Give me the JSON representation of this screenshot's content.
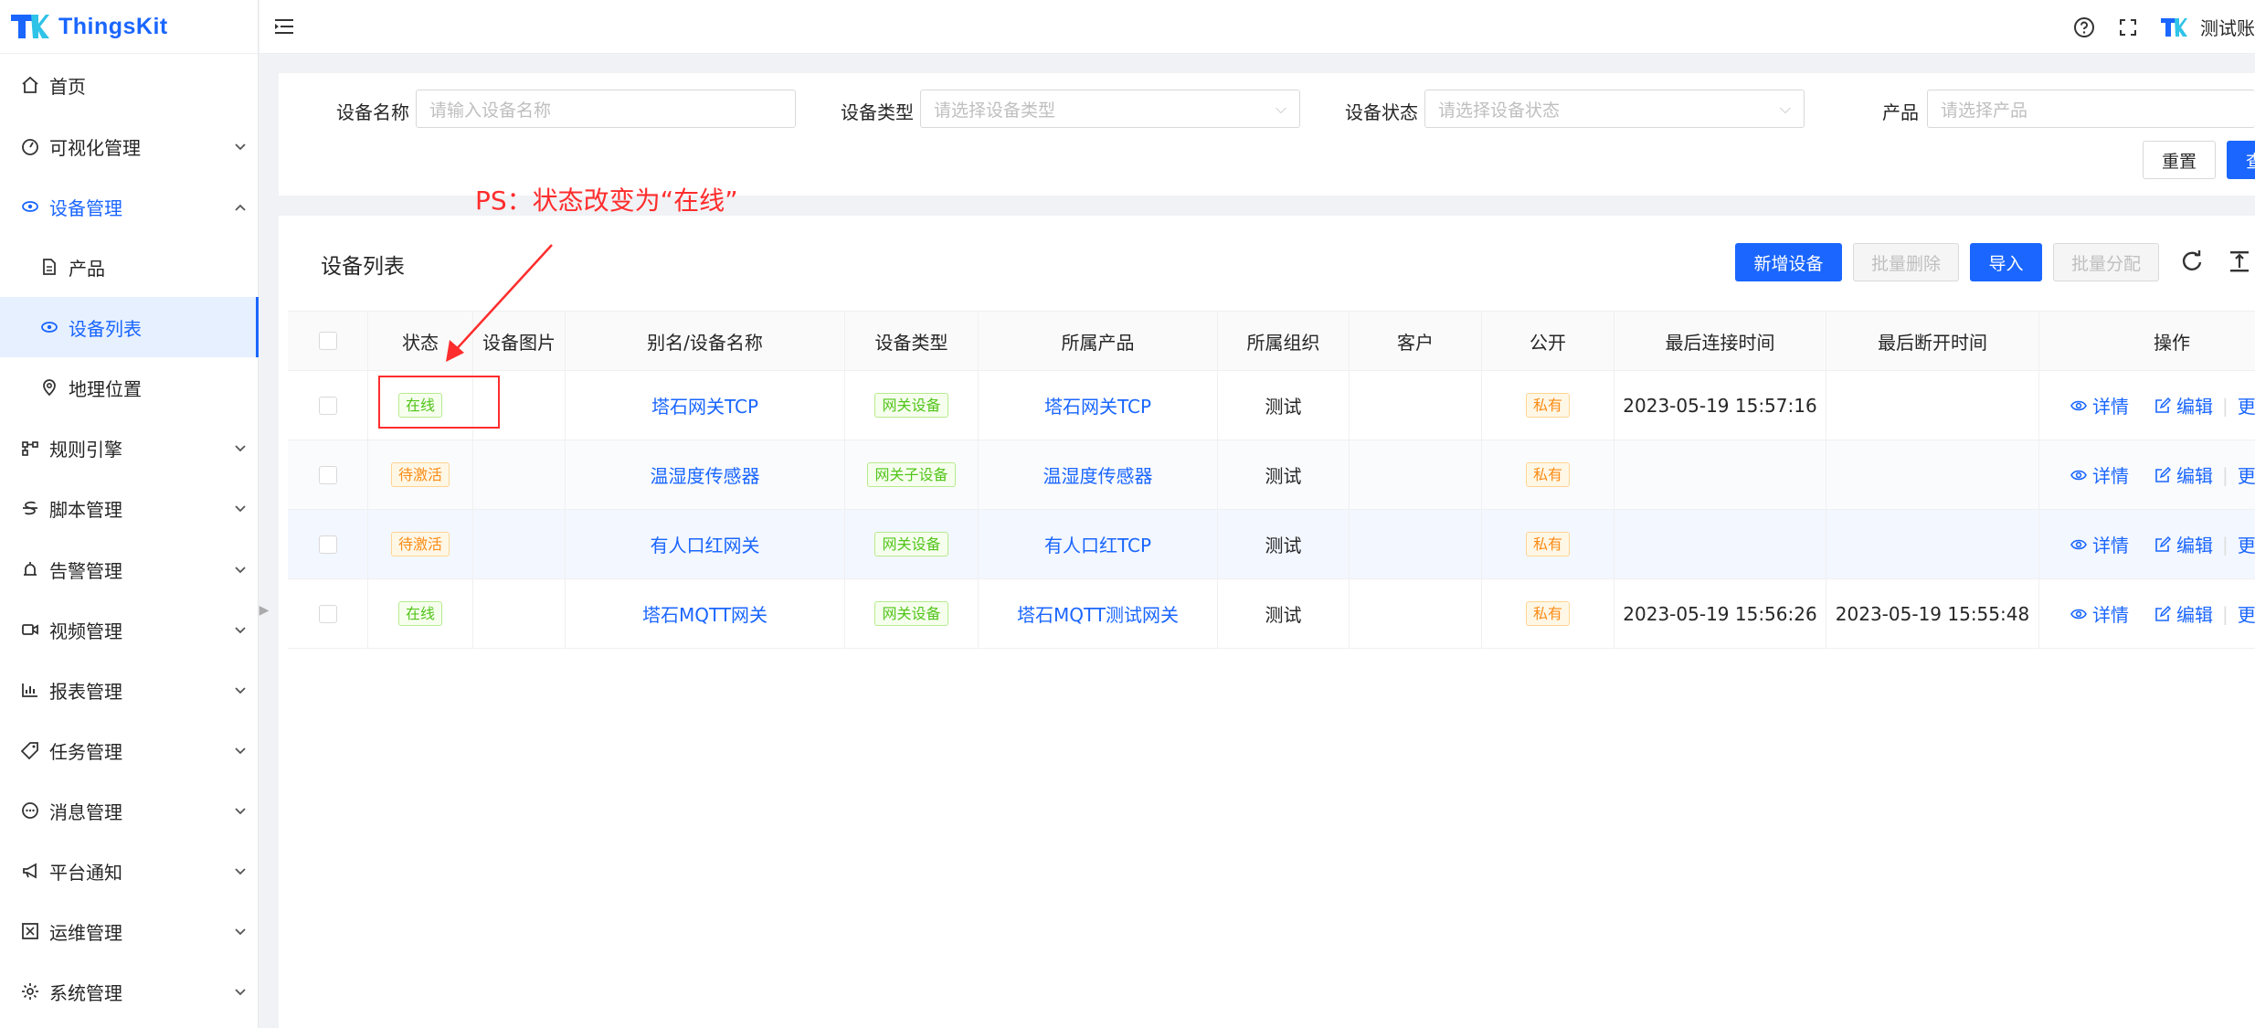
{
  "app": {
    "name": "ThingsKit"
  },
  "colors": {
    "primary": "#1a66ff",
    "online_green": "#52c41a",
    "pending_orange": "#fa8c16",
    "annotation_red": "#ff2d2d"
  },
  "sidebar": {
    "items": [
      {
        "label": "首页",
        "icon": "home-icon",
        "expandable": false
      },
      {
        "label": "可视化管理",
        "icon": "dashboard-icon",
        "expandable": true
      },
      {
        "label": "设备管理",
        "icon": "device-icon",
        "expandable": true,
        "expanded": true
      },
      {
        "label": "产品",
        "icon": "file-icon",
        "sub": true
      },
      {
        "label": "设备列表",
        "icon": "device-icon",
        "sub": true,
        "selected": true
      },
      {
        "label": "地理位置",
        "icon": "location-icon",
        "sub": true
      },
      {
        "label": "规则引擎",
        "icon": "rule-icon",
        "expandable": true
      },
      {
        "label": "脚本管理",
        "icon": "script-icon",
        "expandable": true
      },
      {
        "label": "告警管理",
        "icon": "alarm-icon",
        "expandable": true
      },
      {
        "label": "视频管理",
        "icon": "video-icon",
        "expandable": true
      },
      {
        "label": "报表管理",
        "icon": "chart-icon",
        "expandable": true
      },
      {
        "label": "任务管理",
        "icon": "tag-icon",
        "expandable": true
      },
      {
        "label": "消息管理",
        "icon": "message-icon",
        "expandable": true
      },
      {
        "label": "平台通知",
        "icon": "megaphone-icon",
        "expandable": true
      },
      {
        "label": "运维管理",
        "icon": "ops-icon",
        "expandable": true
      },
      {
        "label": "系统管理",
        "icon": "settings-icon",
        "expandable": true
      }
    ]
  },
  "header": {
    "user": "测试账"
  },
  "search": {
    "fields": [
      {
        "label": "设备名称",
        "placeholder": "请输入设备名称",
        "type": "input"
      },
      {
        "label": "设备类型",
        "placeholder": "请选择设备类型",
        "type": "select"
      },
      {
        "label": "设备状态",
        "placeholder": "请选择设备状态",
        "type": "select"
      },
      {
        "label": "产品",
        "placeholder": "请选择产品",
        "type": "select"
      }
    ],
    "reset_label": "重置",
    "query_label": "查"
  },
  "list": {
    "title": "设备列表",
    "buttons": {
      "add": "新增设备",
      "batch_delete": "批量删除",
      "import": "导入",
      "batch_assign": "批量分配"
    },
    "columns": [
      "状态",
      "设备图片",
      "别名/设备名称",
      "设备类型",
      "所属产品",
      "所属组织",
      "客户",
      "公开",
      "最后连接时间",
      "最后断开时间",
      "操作"
    ],
    "rows": [
      {
        "status": "在线",
        "status_color": "green",
        "name": "塔石网关TCP",
        "type": "网关设备",
        "product": "塔石网关TCP",
        "org": "测试",
        "customer": "",
        "public": "私有",
        "last_connect": "2023-05-19 15:57:16",
        "last_disconnect": ""
      },
      {
        "status": "待激活",
        "status_color": "orange",
        "name": "温湿度传感器",
        "type": "网关子设备",
        "product": "温湿度传感器",
        "org": "测试",
        "customer": "",
        "public": "私有",
        "last_connect": "",
        "last_disconnect": ""
      },
      {
        "status": "待激活",
        "status_color": "orange",
        "name": "有人口红网关",
        "type": "网关设备",
        "product": "有人口红TCP",
        "org": "测试",
        "customer": "",
        "public": "私有",
        "last_connect": "",
        "last_disconnect": ""
      },
      {
        "status": "在线",
        "status_color": "green",
        "name": "塔石MQTT网关",
        "type": "网关设备",
        "product": "塔石MQTT测试网关",
        "org": "测试",
        "customer": "",
        "public": "私有",
        "last_connect": "2023-05-19 15:56:26",
        "last_disconnect": "2023-05-19 15:55:48"
      }
    ],
    "row_actions": {
      "detail": "详情",
      "edit": "编辑",
      "more": "更"
    }
  },
  "annotation": {
    "text": "PS：状态改变为“在线”"
  }
}
